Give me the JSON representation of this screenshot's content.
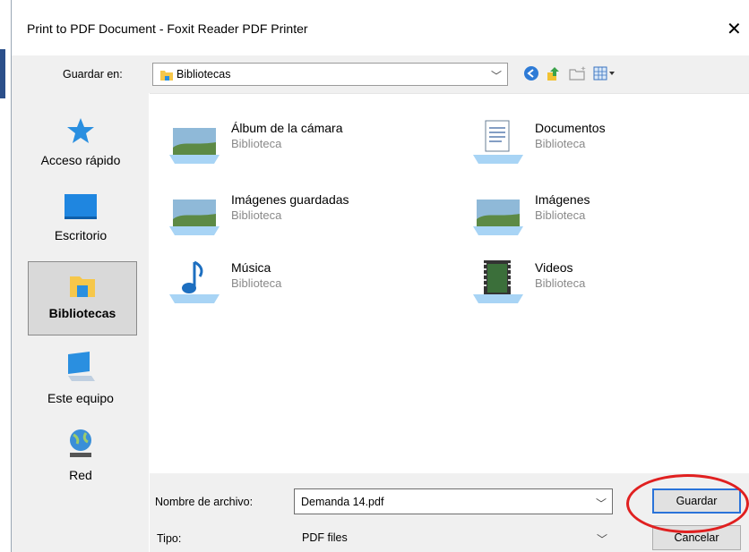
{
  "window": {
    "title": "Print to PDF Document - Foxit Reader PDF Printer",
    "close_glyph": "✕"
  },
  "toolbar": {
    "lookin_label": "Guardar en:",
    "lookin_value": "Bibliotecas",
    "icons": [
      "back-arrow-icon",
      "up-folder-icon",
      "new-folder-icon",
      "view-menu-icon"
    ]
  },
  "places": [
    {
      "label": "Acceso rápido",
      "icon": "star-icon"
    },
    {
      "label": "Escritorio",
      "icon": "desktop-icon"
    },
    {
      "label": "Bibliotecas",
      "icon": "libraries-icon",
      "selected": true
    },
    {
      "label": "Este equipo",
      "icon": "computer-icon"
    },
    {
      "label": "Red",
      "icon": "network-icon"
    }
  ],
  "items": [
    {
      "name": "Álbum de la cámara",
      "type": "Biblioteca",
      "icon": "picture-library-icon"
    },
    {
      "name": "Documentos",
      "type": "Biblioteca",
      "icon": "documents-library-icon"
    },
    {
      "name": "Imágenes guardadas",
      "type": "Biblioteca",
      "icon": "picture-library-icon"
    },
    {
      "name": "Imágenes",
      "type": "Biblioteca",
      "icon": "picture-library-icon"
    },
    {
      "name": "Música",
      "type": "Biblioteca",
      "icon": "music-library-icon"
    },
    {
      "name": "Videos",
      "type": "Biblioteca",
      "icon": "video-library-icon"
    }
  ],
  "bottom": {
    "filename_label": "Nombre de archivo:",
    "filename_value": "Demanda 14.pdf",
    "type_label": "Tipo:",
    "type_value": "PDF files",
    "save_label": "Guardar",
    "cancel_label": "Cancelar"
  },
  "colors": {
    "accent": "#2a73d9",
    "annotation_ring": "#e02020"
  }
}
